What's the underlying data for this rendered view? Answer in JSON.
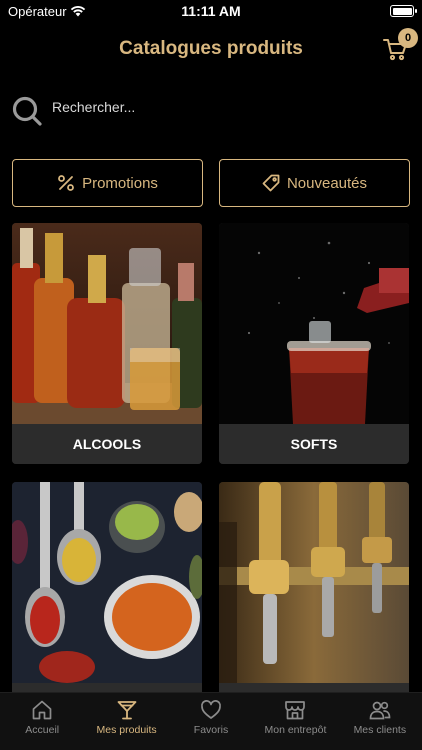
{
  "status": {
    "carrier": "Opérateur",
    "time": "11:11 AM"
  },
  "header": {
    "title": "Catalogues produits",
    "cart_count": "0"
  },
  "search": {
    "placeholder": "Rechercher..."
  },
  "filters": [
    {
      "label": "Promotions",
      "icon": "percent-icon"
    },
    {
      "label": "Nouveautés",
      "icon": "tag-icon"
    }
  ],
  "categories": [
    {
      "label": "ALCOOLS"
    },
    {
      "label": "SOFTS"
    },
    {
      "label": ""
    },
    {
      "label": ""
    }
  ],
  "tabs": [
    {
      "label": "Accueil",
      "icon": "home-icon"
    },
    {
      "label": "Mes produits",
      "icon": "cocktail-glass-icon"
    },
    {
      "label": "Favoris",
      "icon": "heart-icon"
    },
    {
      "label": "Mon entrepôt",
      "icon": "storefront-icon"
    },
    {
      "label": "Mes clients",
      "icon": "people-icon"
    }
  ],
  "colors": {
    "accent": "#d8b780",
    "background": "#000000",
    "inactive": "#8c8c8c"
  }
}
